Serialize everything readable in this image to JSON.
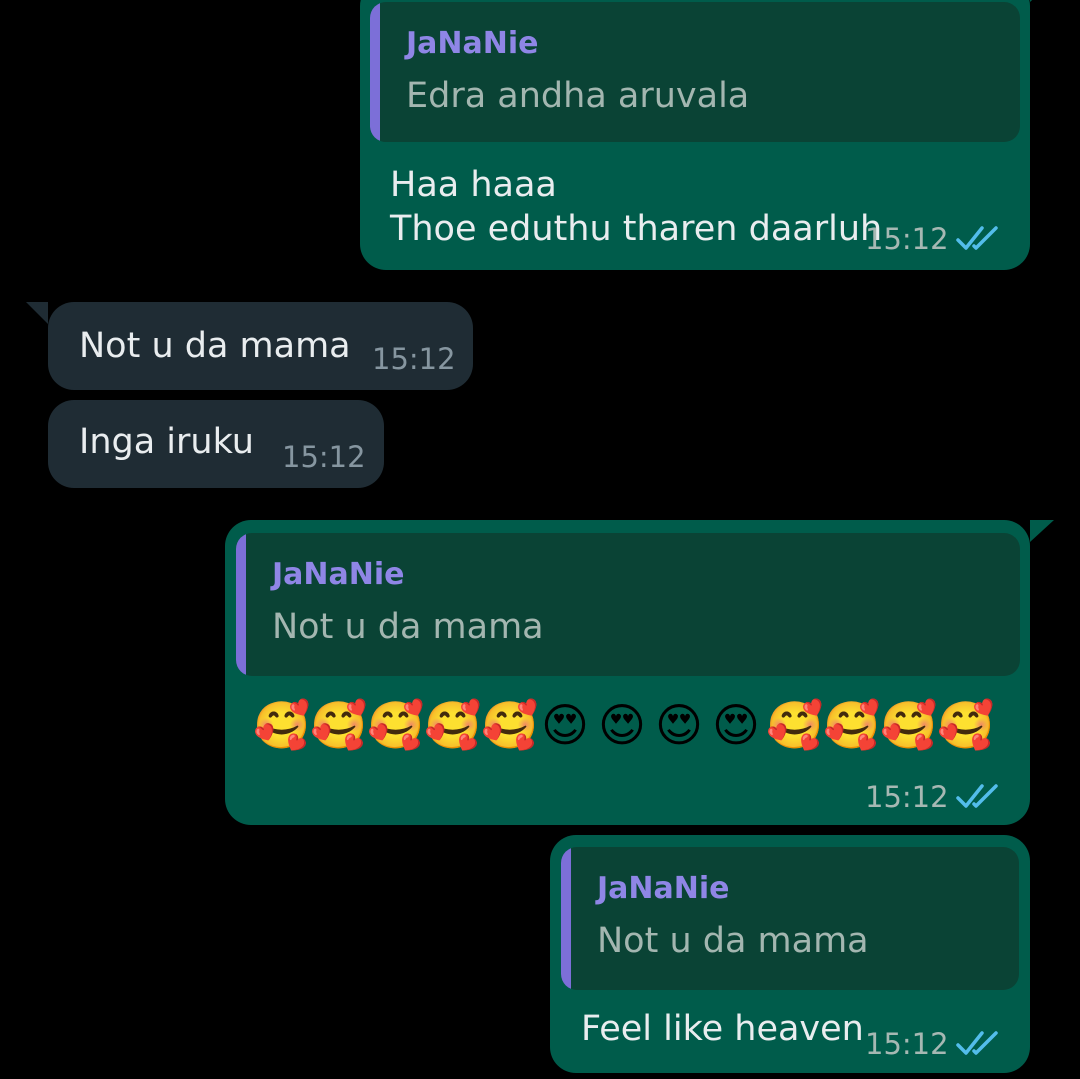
{
  "messages": [
    {
      "id": "m1",
      "direction": "outgoing",
      "quote": {
        "author": "JaNaNie",
        "text": "Edra andha aruvala"
      },
      "text": "Haa haaa\nThoe eduthu tharen daarluh",
      "time": "15:12",
      "status": "read",
      "status_icon": "double-check-icon"
    },
    {
      "id": "m2",
      "direction": "incoming",
      "text": "Not u da mama",
      "time": "15:12"
    },
    {
      "id": "m3",
      "direction": "incoming",
      "text": "Inga iruku",
      "time": "15:12"
    },
    {
      "id": "m4",
      "direction": "outgoing",
      "quote": {
        "author": "JaNaNie",
        "text": "Not u da mama"
      },
      "emojis": [
        "🥰",
        "🥰",
        "🥰",
        "🥰",
        "🥰",
        "😍",
        "😍",
        "😍",
        "😍",
        "🥰",
        "🥰",
        "🥰",
        "🥰"
      ],
      "time": "15:12",
      "status": "read",
      "status_icon": "double-check-icon"
    },
    {
      "id": "m5",
      "direction": "outgoing",
      "quote": {
        "author": "JaNaNie",
        "text": "Not u da mama"
      },
      "text": "Feel like heaven",
      "time": "15:12",
      "status": "read",
      "status_icon": "double-check-icon"
    }
  ],
  "colors": {
    "background": "#000000",
    "outgoing_bubble": "#005c4b",
    "incoming_bubble": "#1f2c34",
    "quote_bar": "#7c6fd8",
    "quote_author": "#8f86e6",
    "read_ticks": "#53bdeb"
  }
}
